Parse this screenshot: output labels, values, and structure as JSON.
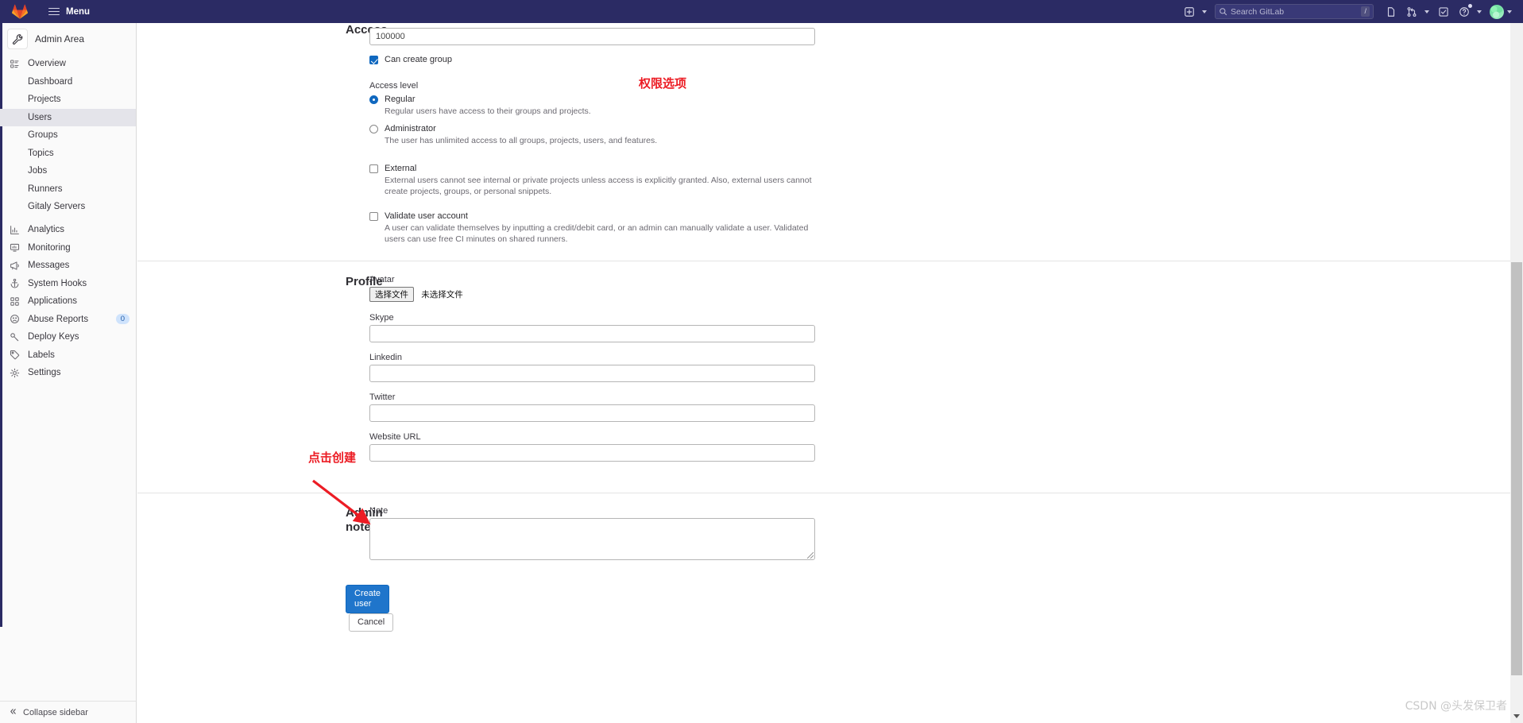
{
  "topnav": {
    "logo_icon": "gitlab-logo-icon",
    "menu_label": "Menu",
    "search_placeholder": "Search GitLab",
    "search_shortcut": "/",
    "icons": {
      "create_new": "plus-square-icon",
      "issues": "issues-icon",
      "merge_requests": "merge-request-icon",
      "todos": "todo-checkbox-icon",
      "help": "question-circle-icon",
      "avatar": "user-avatar-icon"
    }
  },
  "sidebar": {
    "context_title": "Admin Area",
    "context_icon": "wrench-icon",
    "items": [
      {
        "label": "Overview",
        "icon": "overview-grid-icon",
        "level": 0,
        "active": false
      },
      {
        "label": "Dashboard",
        "icon": "",
        "level": 1,
        "active": false
      },
      {
        "label": "Projects",
        "icon": "",
        "level": 1,
        "active": false
      },
      {
        "label": "Users",
        "icon": "",
        "level": 1,
        "active": true
      },
      {
        "label": "Groups",
        "icon": "",
        "level": 1,
        "active": false
      },
      {
        "label": "Topics",
        "icon": "",
        "level": 1,
        "active": false
      },
      {
        "label": "Jobs",
        "icon": "",
        "level": 1,
        "active": false
      },
      {
        "label": "Runners",
        "icon": "",
        "level": 1,
        "active": false
      },
      {
        "label": "Gitaly Servers",
        "icon": "",
        "level": 1,
        "active": false
      },
      {
        "label": "Analytics",
        "icon": "chart-bar-icon",
        "level": 0,
        "active": false
      },
      {
        "label": "Monitoring",
        "icon": "monitor-icon",
        "level": 0,
        "active": false
      },
      {
        "label": "Messages",
        "icon": "megaphone-icon",
        "level": 0,
        "active": false
      },
      {
        "label": "System Hooks",
        "icon": "hook-anchor-icon",
        "level": 0,
        "active": false
      },
      {
        "label": "Applications",
        "icon": "applications-grid-icon",
        "level": 0,
        "active": false
      },
      {
        "label": "Abuse Reports",
        "icon": "abuse-face-icon",
        "level": 0,
        "active": false,
        "badge": "0"
      },
      {
        "label": "Deploy Keys",
        "icon": "key-icon",
        "level": 0,
        "active": false
      },
      {
        "label": "Labels",
        "icon": "label-tag-icon",
        "level": 0,
        "active": false
      },
      {
        "label": "Settings",
        "icon": "gear-icon",
        "level": 0,
        "active": false
      }
    ],
    "collapse_label": "Collapse sidebar",
    "collapse_icon": "chevron-double-left-icon"
  },
  "main": {
    "sections": {
      "access": {
        "heading": "Access",
        "projects_limit": {
          "value": "100000"
        },
        "can_create_group": {
          "label": "Can create group",
          "checked": true
        },
        "access_level": {
          "label": "Access level",
          "options": [
            {
              "title": "Regular",
              "desc": "Regular users have access to their groups and projects.",
              "selected": true
            },
            {
              "title": "Administrator",
              "desc": "The user has unlimited access to all groups, projects, users, and features.",
              "selected": false
            }
          ]
        },
        "external": {
          "title": "External",
          "desc": "External users cannot see internal or private projects unless access is explicitly granted. Also, external users cannot create projects, groups, or personal snippets.",
          "checked": false
        },
        "validate": {
          "title": "Validate user account",
          "desc": "A user can validate themselves by inputting a credit/debit card, or an admin can manually validate a user. Validated users can use free CI minutes on shared runners.",
          "checked": false
        }
      },
      "profile": {
        "heading": "Profile",
        "avatar": {
          "label": "Avatar",
          "button_label": "选择文件",
          "status_text": "未选择文件"
        },
        "fields": [
          {
            "label": "Skype",
            "value": "",
            "name": "skype"
          },
          {
            "label": "Linkedin",
            "value": "",
            "name": "linkedin"
          },
          {
            "label": "Twitter",
            "value": "",
            "name": "twitter"
          },
          {
            "label": "Website URL",
            "value": "",
            "name": "website-url"
          }
        ]
      },
      "admin_notes": {
        "heading": "Admin notes",
        "note": {
          "label": "Note",
          "value": ""
        }
      }
    },
    "actions": {
      "submit_label": "Create user",
      "cancel_label": "Cancel"
    }
  },
  "annotations": [
    {
      "text": "权限选项",
      "name": "annotation-access-level"
    },
    {
      "text": "点击创建",
      "name": "annotation-create-user"
    }
  ],
  "watermark": "CSDN @头发保卫者",
  "colors": {
    "navbar_bg": "#2b2b64",
    "accent_blue": "#1f75cb",
    "checkbox_blue": "#1068bf",
    "annotation_red": "#ec1c24",
    "sidebar_bg": "#fafafa",
    "active_item_bg": "#e4e4ea"
  }
}
